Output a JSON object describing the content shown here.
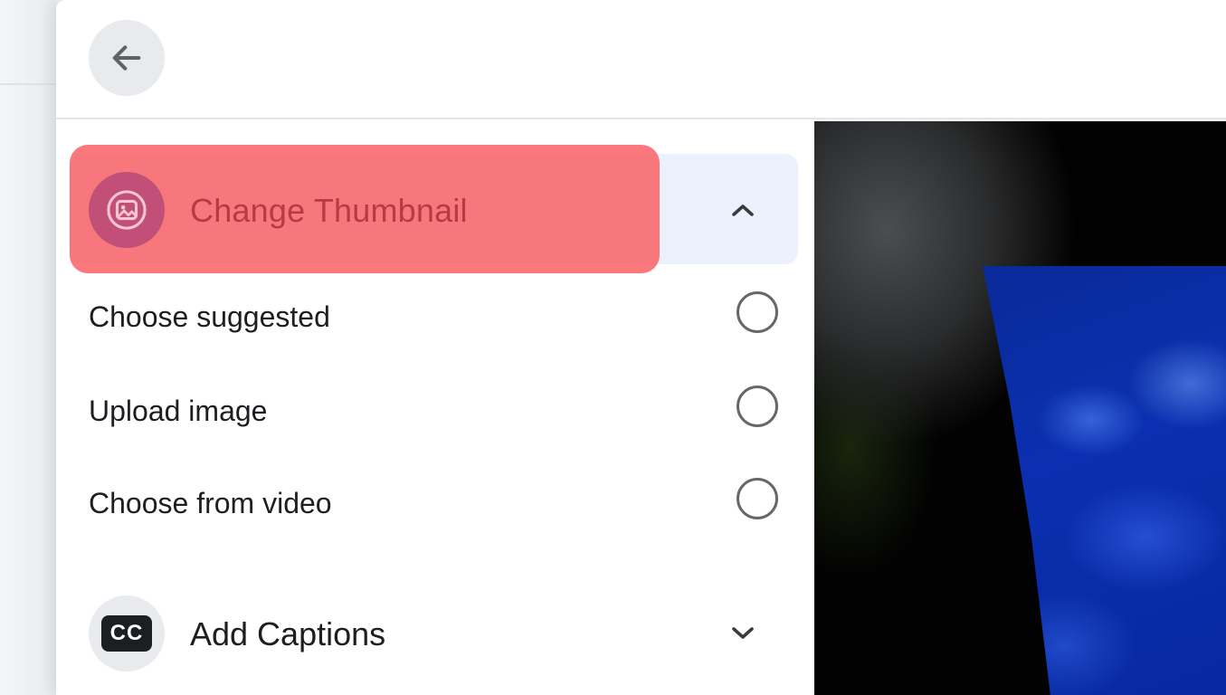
{
  "dialog": {
    "back_button_icon": "arrow-left-icon"
  },
  "thumbnail_section": {
    "title": "Change Thumbnail",
    "icon": "image-icon",
    "expanded": true,
    "options": [
      {
        "label": "Choose suggested",
        "selected": false
      },
      {
        "label": "Upload image",
        "selected": false
      },
      {
        "label": "Choose from video",
        "selected": false
      }
    ]
  },
  "captions_section": {
    "title": "Add Captions",
    "icon_text": "CC",
    "expanded": false
  },
  "colors": {
    "highlight": "#fa5c60",
    "header_bg": "#ecf2fd",
    "preview_blue": "#0b2fb0"
  }
}
